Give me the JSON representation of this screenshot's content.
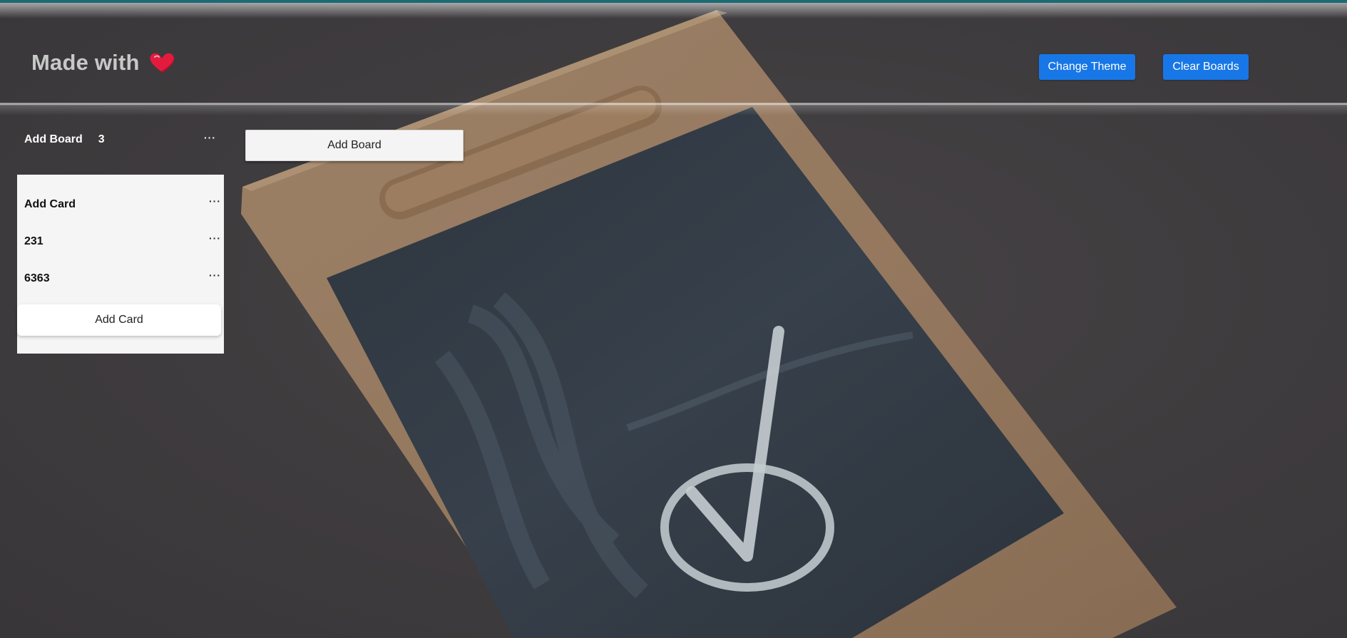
{
  "header": {
    "brand_text": "Made with",
    "brand_icon": "heart-icon",
    "change_theme_label": "Change Theme",
    "clear_boards_label": "Clear Boards"
  },
  "board": {
    "title": "Add Board",
    "count": "3",
    "more_icon": "more-horizontal-icon",
    "more_glyph": "···",
    "cards": [
      {
        "title": "Add Card"
      },
      {
        "title": "231"
      },
      {
        "title": "6363"
      }
    ],
    "add_card_label": "Add Card"
  },
  "add_board_label": "Add Board",
  "colors": {
    "accent": "#1877e6",
    "top_strip": "#1a6b74",
    "background": "#474447",
    "panel": "#f5f5f5"
  }
}
